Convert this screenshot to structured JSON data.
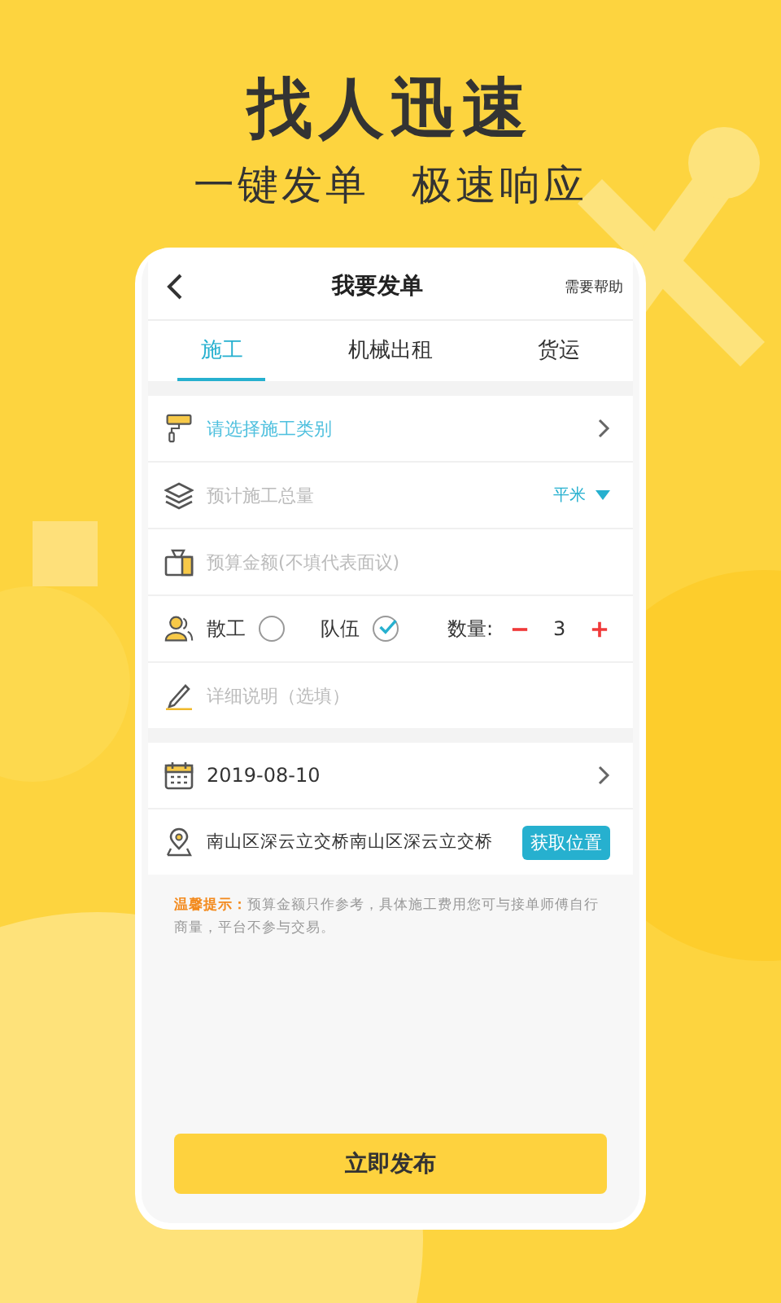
{
  "headline": {
    "title": "找人迅速",
    "taglines": [
      "一键发单",
      "极速响应"
    ]
  },
  "header": {
    "title": "我要发单",
    "help": "需要帮助"
  },
  "tabs": [
    {
      "label": "施工",
      "selected": true
    },
    {
      "label": "机械出租",
      "selected": false
    },
    {
      "label": "货运",
      "selected": false
    }
  ],
  "form_rows": [
    {
      "kind": "select",
      "text": "请选择施工类别"
    },
    {
      "kind": "unit",
      "placeholder": "预计施工总量",
      "unit": "平米"
    },
    {
      "kind": "input",
      "placeholder": "预算金额(不填代表面议)"
    },
    {
      "kind": "crew",
      "options": [
        {
          "label": "散工",
          "selected": false
        },
        {
          "label": "队伍",
          "selected": true
        }
      ],
      "quantity_label": "数量:",
      "quantity": "3"
    },
    {
      "kind": "input",
      "placeholder": "详细说明（选填）"
    }
  ],
  "date": "2019-08-10",
  "location": {
    "value": "南山区深云立交桥南山区深云立交桥",
    "button": "获取位置"
  },
  "tip": {
    "label": "温馨提示：",
    "text": "预算金额只作参考，具体施工费用您可与接单师傅自行商量，平台不参与交易。"
  },
  "submit": "立即发布"
}
